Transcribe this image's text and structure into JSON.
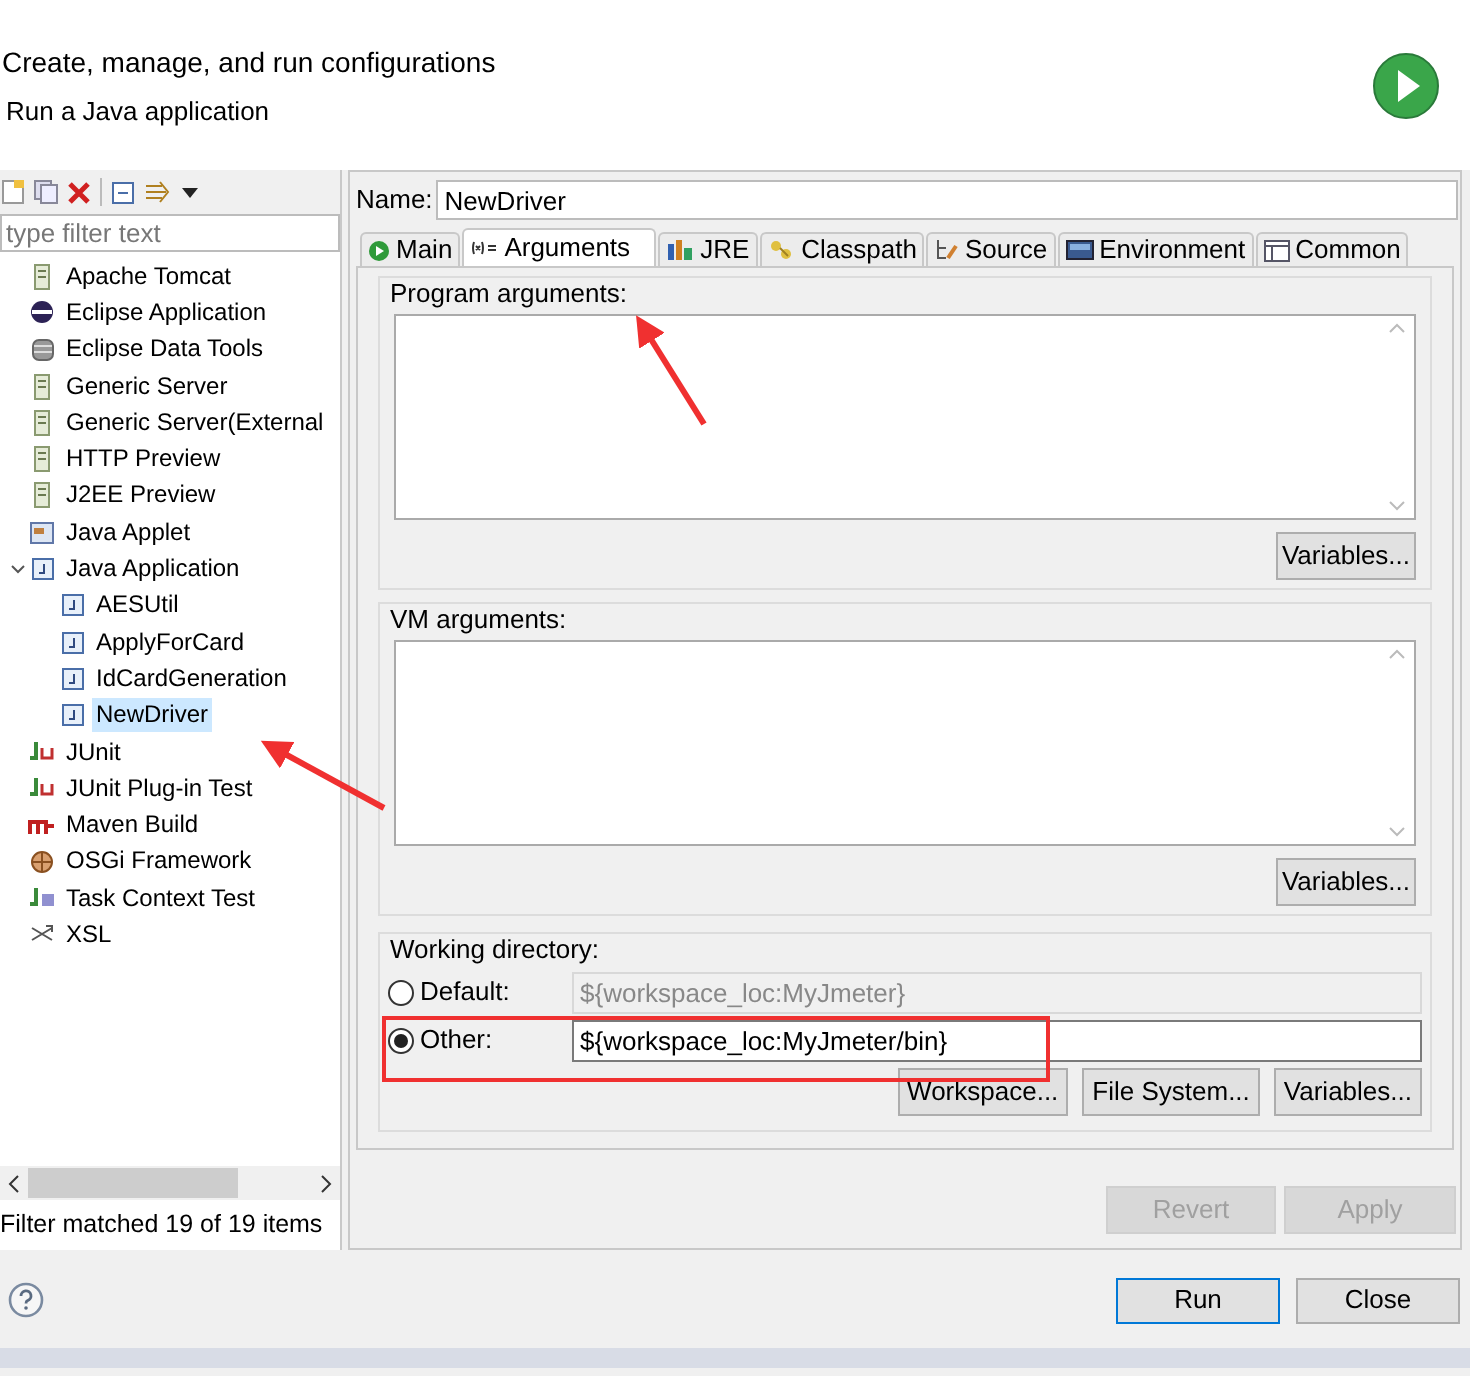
{
  "header": {
    "title": "Create, manage, and run configurations",
    "description": "Run a Java application"
  },
  "sidebar": {
    "filter": {
      "placeholder": "type filter text"
    },
    "items": [
      {
        "label": "Apache Tomcat",
        "kind": "server",
        "selected": false
      },
      {
        "label": "Eclipse Application",
        "kind": "eclipse",
        "selected": false
      },
      {
        "label": "Eclipse Data Tools",
        "kind": "database",
        "selected": false
      },
      {
        "label": "Generic Server",
        "kind": "server",
        "selected": false
      },
      {
        "label": "Generic Server(External",
        "kind": "server",
        "selected": false
      },
      {
        "label": "HTTP Preview",
        "kind": "server",
        "selected": false
      },
      {
        "label": "J2EE Preview",
        "kind": "server",
        "selected": false
      },
      {
        "label": "Java Applet",
        "kind": "applet",
        "selected": false
      },
      {
        "label": "Java Application",
        "kind": "java",
        "selected": false,
        "expanded": true,
        "children": [
          {
            "label": "AESUtil",
            "kind": "java",
            "selected": false
          },
          {
            "label": "ApplyForCard",
            "kind": "java",
            "selected": false
          },
          {
            "label": "IdCardGeneration",
            "kind": "java",
            "selected": false
          },
          {
            "label": "NewDriver",
            "kind": "java",
            "selected": true
          }
        ]
      },
      {
        "label": "JUnit",
        "kind": "junit",
        "selected": false
      },
      {
        "label": "JUnit Plug-in Test",
        "kind": "junit",
        "selected": false
      },
      {
        "label": "Maven Build",
        "kind": "maven",
        "selected": false
      },
      {
        "label": "OSGi Framework",
        "kind": "osgi",
        "selected": false
      },
      {
        "label": "Task Context Test",
        "kind": "task",
        "selected": false
      },
      {
        "label": "XSL",
        "kind": "xsl",
        "selected": false
      }
    ],
    "status": "Filter matched 19 of 19 items"
  },
  "editor": {
    "name_label": "Name:",
    "name_value": "NewDriver",
    "tabs": [
      {
        "label": "Main",
        "kind": "main",
        "selected": false
      },
      {
        "label": "Arguments",
        "kind": "args",
        "selected": true
      },
      {
        "label": "JRE",
        "kind": "jre",
        "selected": false
      },
      {
        "label": "Classpath",
        "kind": "classpath",
        "selected": false
      },
      {
        "label": "Source",
        "kind": "source",
        "selected": false
      },
      {
        "label": "Environment",
        "kind": "env",
        "selected": false
      },
      {
        "label": "Common",
        "kind": "common",
        "selected": false
      }
    ],
    "program_arguments": {
      "label": "Program arguments:",
      "button": "Variables..."
    },
    "vm_arguments": {
      "label": "VM arguments:",
      "button": "Variables..."
    },
    "working_directory": {
      "label": "Working directory:",
      "options": [
        {
          "label": "Default:",
          "value": "${workspace_loc:MyJmeter}",
          "selected": false
        },
        {
          "label": "Other:",
          "value": "${workspace_loc:MyJmeter/bin}",
          "selected": true
        }
      ],
      "buttons": [
        "Workspace...",
        "File System...",
        "Variables..."
      ]
    },
    "revert": {
      "label": "Revert",
      "disabled": true
    },
    "apply": {
      "label": "Apply",
      "disabled": true
    }
  },
  "footer": {
    "buttons": [
      "Run",
      "Close"
    ]
  }
}
